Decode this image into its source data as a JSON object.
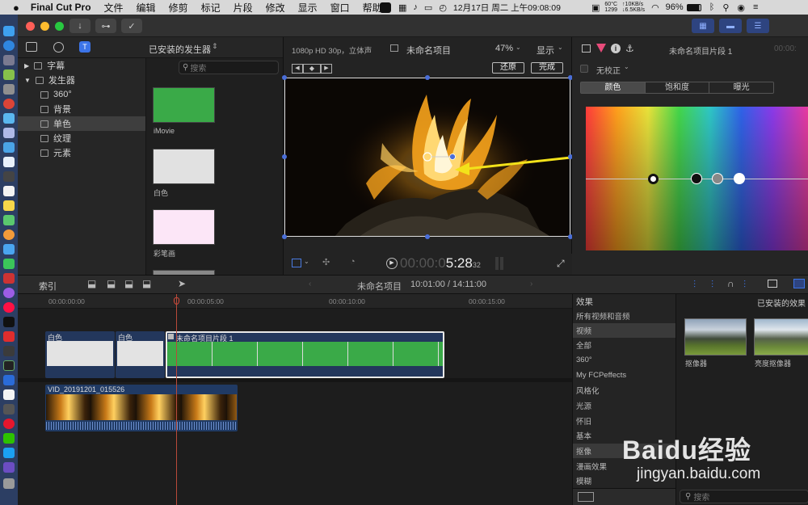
{
  "menubar": {
    "app_name": "Final Cut Pro",
    "items": [
      "文件",
      "编辑",
      "修剪",
      "标记",
      "片段",
      "修改",
      "显示",
      "窗口",
      "帮助"
    ],
    "cpu_temp": "60°C",
    "cpu_rpm": "1299",
    "net_up": "10KB/s",
    "net_down": "6.5KB/s",
    "battery": "96%",
    "datetime": "12月17日 周二 上午09:08:09"
  },
  "library": {
    "header": "已安装的发生器",
    "search_placeholder": "搜索",
    "items": [
      {
        "label": "字幕"
      },
      {
        "label": "发生器"
      },
      {
        "label": "360°"
      },
      {
        "label": "背景"
      },
      {
        "label": "单色"
      },
      {
        "label": "纹理"
      },
      {
        "label": "元素"
      }
    ],
    "thumbs": [
      {
        "label": "iMovie",
        "color": "#3aaa48"
      },
      {
        "label": "白色",
        "color": "#e1e1e1"
      },
      {
        "label": "彩笔画",
        "color": "#fce6f7"
      }
    ]
  },
  "viewer": {
    "format": "1080p HD 30p，立体声",
    "project": "未命名项目",
    "zoom": "47%",
    "view_menu": "显示",
    "revert_button": "还原",
    "done_button": "完成",
    "timecode_dim": "00:00:0",
    "timecode": "5:28",
    "timecode_frames": "32"
  },
  "inspector": {
    "title": "未命名项目片段 1",
    "timecode": "00:00:",
    "correction": "无校正",
    "tabs": [
      "颜色",
      "饱和度",
      "曝光"
    ],
    "selected_tab": "颜色"
  },
  "midbar": {
    "index": "索引",
    "project": "未命名项目",
    "duration": "10:01:00 / 14:11:00"
  },
  "timeline": {
    "ruler": [
      "00:00:00:00",
      "00:00:05:00",
      "00:00:10:00",
      "00:00:15:00"
    ],
    "clips": [
      {
        "label": "白色"
      },
      {
        "label": "白色"
      },
      {
        "label": "未命名项目片段 1"
      }
    ],
    "video_clip": "VID_20191201_015526"
  },
  "effects": {
    "header": "效果",
    "categories": [
      "所有视频和音频",
      "视频",
      "全部",
      "360°",
      "My FCPeffects",
      "风格化",
      "光源",
      "怀旧",
      "基本",
      "抠像",
      "漫画效果",
      "模糊"
    ],
    "selected": "抠像",
    "browser_header": "已安装的效果",
    "items": [
      {
        "label": "抠像器"
      },
      {
        "label": "亮度抠像器"
      }
    ],
    "search_placeholder": "搜索"
  },
  "watermark": {
    "brand": "Baidu经验",
    "url": "jingyan.baidu.com"
  },
  "colors": {
    "accent": "#3c74e8",
    "green_clip": "#3aaa48",
    "arrow": "#f3e21a"
  }
}
